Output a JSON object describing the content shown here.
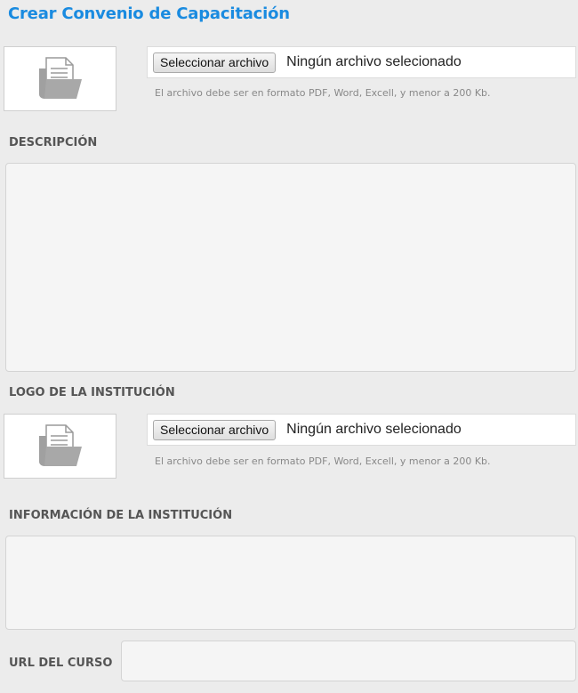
{
  "page": {
    "title": "Crear Convenio de Capacitación"
  },
  "file_upload_1": {
    "button_label": "Seleccionar archivo",
    "status": "Ningún archivo selecionado",
    "hint": "El archivo debe ser en formato PDF, Word, Excell, y menor a 200 Kb.",
    "icon": "document-folder-icon"
  },
  "descripcion": {
    "label": "DESCRIPCIÓN",
    "value": ""
  },
  "logo": {
    "label": "LOGO DE LA INSTITUCIÓN",
    "button_label": "Seleccionar archivo",
    "status": "Ningún archivo selecionado",
    "hint": "El archivo debe ser en formato PDF, Word, Excell, y menor a 200 Kb.",
    "icon": "document-folder-icon"
  },
  "informacion": {
    "label": "INFORMACIÓN DE LA INSTITUCIÓN",
    "value": ""
  },
  "url_curso": {
    "label": "URL DEL CURSO",
    "value": ""
  },
  "colors": {
    "accent": "#1a8be0",
    "background": "#ececec"
  }
}
